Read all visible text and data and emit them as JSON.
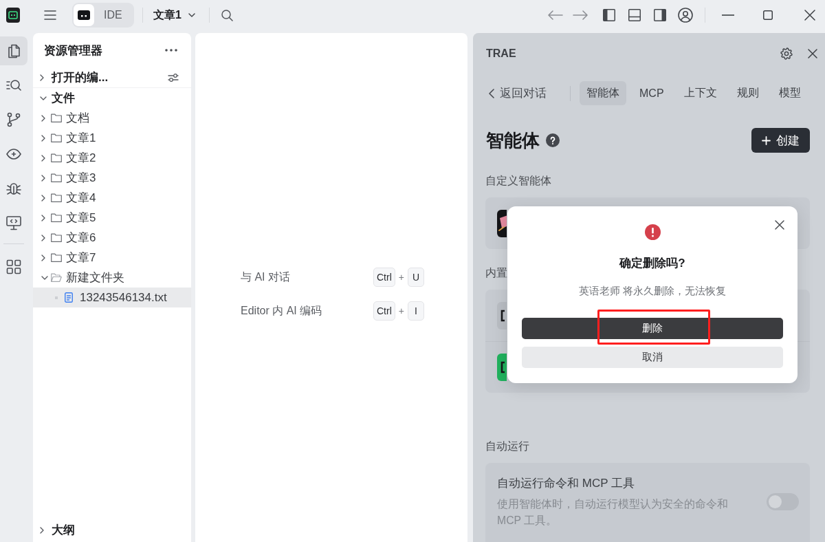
{
  "title_bar": {
    "mode_switch": [
      {
        "kind": "chat",
        "selected": true
      },
      {
        "kind": "ide",
        "label": "IDE",
        "selected": false
      }
    ],
    "document_title": "文章1"
  },
  "activity_bar": {
    "items": [
      {
        "kind": "explorer",
        "selected": true
      },
      {
        "kind": "search",
        "selected": false
      },
      {
        "kind": "source_control",
        "selected": false
      },
      {
        "kind": "preview",
        "selected": false
      },
      {
        "kind": "debug",
        "selected": false
      },
      {
        "kind": "remote",
        "selected": false
      }
    ],
    "bottom_items": [
      {
        "kind": "extensions",
        "selected": false
      }
    ]
  },
  "explorer": {
    "title": "资源管理器",
    "open_editors": {
      "label": "打开的编...",
      "expanded": false
    },
    "files": {
      "label": "文件",
      "expanded": true,
      "tree": [
        {
          "kind": "folder",
          "label": "文档",
          "expanded": false,
          "selected": false
        },
        {
          "kind": "folder",
          "label": "文章1",
          "expanded": false,
          "selected": false
        },
        {
          "kind": "folder",
          "label": "文章2",
          "expanded": false,
          "selected": false
        },
        {
          "kind": "folder",
          "label": "文章3",
          "expanded": false,
          "selected": false
        },
        {
          "kind": "folder",
          "label": "文章4",
          "expanded": false,
          "selected": false
        },
        {
          "kind": "folder",
          "label": "文章5",
          "expanded": false,
          "selected": false
        },
        {
          "kind": "folder",
          "label": "文章6",
          "expanded": false,
          "selected": false
        },
        {
          "kind": "folder",
          "label": "文章7",
          "expanded": false,
          "selected": false
        },
        {
          "kind": "folder",
          "label": "新建文件夹",
          "expanded": true,
          "selected": false,
          "children": [
            {
              "kind": "file",
              "label": "13243546134.txt",
              "selected": true
            }
          ]
        }
      ]
    },
    "outline": {
      "label": "大纲",
      "expanded": false
    }
  },
  "editor": {
    "shortcuts": [
      {
        "label": "与 AI 对话",
        "keys": [
          "Ctrl",
          "U"
        ],
        "joiner": "+"
      },
      {
        "label": "Editor 内 AI 编码",
        "keys": [
          "Ctrl",
          "I"
        ],
        "joiner": "+"
      }
    ]
  },
  "assistant_panel": {
    "title": "TRAE",
    "back_label": "返回对话",
    "tabs": [
      {
        "label": "智能体",
        "selected": true
      },
      {
        "label": "MCP",
        "selected": false
      },
      {
        "label": "上下文",
        "selected": false
      },
      {
        "label": "规则",
        "selected": false
      },
      {
        "label": "模型",
        "selected": false
      }
    ],
    "heading": "智能体",
    "create_label": "创建",
    "sections": [
      {
        "kind": "agents",
        "label": "自定义智能体",
        "agents": [
          {
            "kind": "avatar"
          }
        ]
      },
      {
        "kind": "agents",
        "label": "内置",
        "agents": [
          {
            "kind": "builder",
            "color": "#b9bdc3"
          },
          {
            "kind": "builder",
            "color": "#21b25e"
          }
        ]
      },
      {
        "kind": "setting",
        "label": "自动运行",
        "title": "自动运行命令和 MCP 工具",
        "description": "使用智能体时，自动运行模型认为安全的命令和 MCP 工具。",
        "on": false
      }
    ]
  },
  "dialog": {
    "title": "确定删除吗?",
    "message": "英语老师 将永久删除，无法恢复",
    "confirm": {
      "label": "删除",
      "highlighted": true
    },
    "cancel": {
      "label": "取消"
    }
  }
}
